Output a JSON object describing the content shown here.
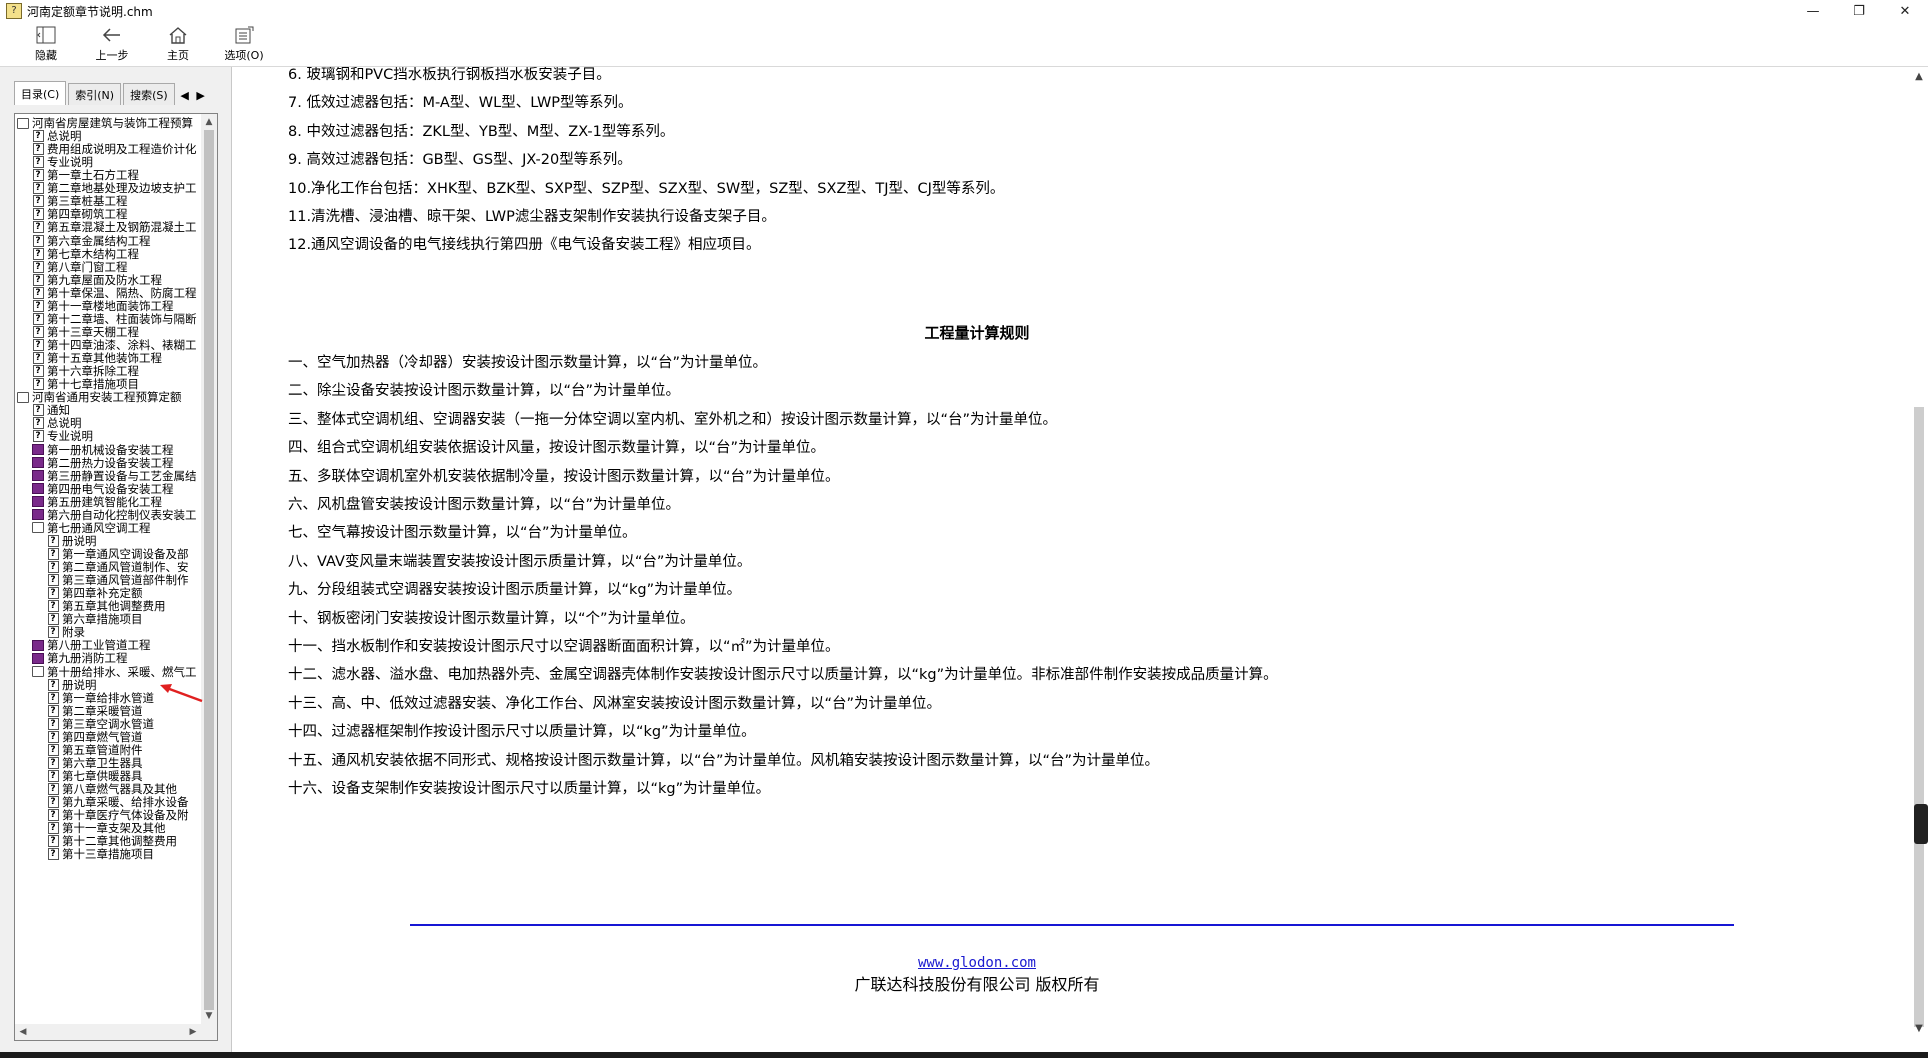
{
  "window": {
    "title": "河南定额章节说明.chm",
    "minimize": "—",
    "maximize": "❐",
    "close": "✕"
  },
  "toolbar": {
    "hide_label": "隐藏",
    "back_label": "上一步",
    "home_label": "主页",
    "options_label": "选项(O)"
  },
  "tabs": {
    "contents": "目录(C)",
    "index": "索引(N)",
    "search": "搜索(S)",
    "prev": "◀",
    "next": "▶"
  },
  "tree": [
    {
      "label": "河南省房屋建筑与装饰工程预算",
      "icon": "open-book-icon",
      "level": 0
    },
    {
      "label": "总说明",
      "icon": "q-icon",
      "level": 1
    },
    {
      "label": "费用组成说明及工程造价计化",
      "icon": "q-icon",
      "level": 1
    },
    {
      "label": "专业说明",
      "icon": "q-icon",
      "level": 1
    },
    {
      "label": "第一章土石方工程",
      "icon": "q-icon",
      "level": 1
    },
    {
      "label": "第二章地基处理及边坡支护工",
      "icon": "q-icon",
      "level": 1
    },
    {
      "label": "第三章桩基工程",
      "icon": "q-icon",
      "level": 1
    },
    {
      "label": "第四章砌筑工程",
      "icon": "q-icon",
      "level": 1
    },
    {
      "label": "第五章混凝土及钢筋混凝土工",
      "icon": "q-icon",
      "level": 1
    },
    {
      "label": "第六章金属结构工程",
      "icon": "q-icon",
      "level": 1
    },
    {
      "label": "第七章木结构工程",
      "icon": "q-icon",
      "level": 1
    },
    {
      "label": "第八章门窗工程",
      "icon": "q-icon",
      "level": 1
    },
    {
      "label": "第九章屋面及防水工程",
      "icon": "q-icon",
      "level": 1
    },
    {
      "label": "第十章保温、隔热、防腐工程",
      "icon": "q-icon",
      "level": 1
    },
    {
      "label": "第十一章楼地面装饰工程",
      "icon": "q-icon",
      "level": 1
    },
    {
      "label": "第十二章墙、柱面装饰与隔断",
      "icon": "q-icon",
      "level": 1
    },
    {
      "label": "第十三章天棚工程",
      "icon": "q-icon",
      "level": 1
    },
    {
      "label": "第十四章油漆、涂料、裱糊工",
      "icon": "q-icon",
      "level": 1
    },
    {
      "label": "第十五章其他装饰工程",
      "icon": "q-icon",
      "level": 1
    },
    {
      "label": "第十六章拆除工程",
      "icon": "q-icon",
      "level": 1
    },
    {
      "label": "第十七章措施项目",
      "icon": "q-icon",
      "level": 1
    },
    {
      "label": "河南省通用安装工程预算定额",
      "icon": "open-book-icon",
      "level": 0
    },
    {
      "label": "通知",
      "icon": "q-icon",
      "level": 1
    },
    {
      "label": "总说明",
      "icon": "q-icon",
      "level": 1
    },
    {
      "label": "专业说明",
      "icon": "q-icon",
      "level": 1
    },
    {
      "label": "第一册机械设备安装工程",
      "icon": "book-icon",
      "level": 1
    },
    {
      "label": "第二册热力设备安装工程",
      "icon": "book-icon",
      "level": 1
    },
    {
      "label": "第三册静置设备与工艺金属结",
      "icon": "book-icon",
      "level": 1
    },
    {
      "label": "第四册电气设备安装工程",
      "icon": "book-icon",
      "level": 1
    },
    {
      "label": "第五册建筑智能化工程",
      "icon": "book-icon",
      "level": 1
    },
    {
      "label": "第六册自动化控制仪表安装工",
      "icon": "book-icon",
      "level": 1
    },
    {
      "label": "第七册通风空调工程",
      "icon": "open-book-icon",
      "level": 1
    },
    {
      "label": "册说明",
      "icon": "q-icon",
      "level": 2
    },
    {
      "label": "第一章通风空调设备及部",
      "icon": "q-icon",
      "level": 2
    },
    {
      "label": "第二章通风管道制作、安",
      "icon": "q-icon",
      "level": 2
    },
    {
      "label": "第三章通风管道部件制作",
      "icon": "q-icon",
      "level": 2
    },
    {
      "label": "第四章补充定额",
      "icon": "q-icon",
      "level": 2
    },
    {
      "label": "第五章其他调整费用",
      "icon": "q-icon",
      "level": 2
    },
    {
      "label": "第六章措施项目",
      "icon": "q-icon",
      "level": 2
    },
    {
      "label": "附录",
      "icon": "q-icon",
      "level": 2
    },
    {
      "label": "第八册工业管道工程",
      "icon": "book-icon",
      "level": 1
    },
    {
      "label": "第九册消防工程",
      "icon": "book-icon",
      "level": 1
    },
    {
      "label": "第十册给排水、采暖、燃气工",
      "icon": "open-book-icon",
      "level": 1
    },
    {
      "label": "册说明",
      "icon": "q-icon",
      "level": 2
    },
    {
      "label": "第一章给排水管道",
      "icon": "q-icon",
      "level": 2
    },
    {
      "label": "第二章采暖管道",
      "icon": "q-icon",
      "level": 2
    },
    {
      "label": "第三章空调水管道",
      "icon": "q-icon",
      "level": 2
    },
    {
      "label": "第四章燃气管道",
      "icon": "q-icon",
      "level": 2
    },
    {
      "label": "第五章管道附件",
      "icon": "q-icon",
      "level": 2
    },
    {
      "label": "第六章卫生器具",
      "icon": "q-icon",
      "level": 2
    },
    {
      "label": "第七章供暖器具",
      "icon": "q-icon",
      "level": 2
    },
    {
      "label": "第八章燃气器具及其他",
      "icon": "q-icon",
      "level": 2
    },
    {
      "label": "第九章采暖、给排水设备",
      "icon": "q-icon",
      "level": 2
    },
    {
      "label": "第十章医疗气体设备及附",
      "icon": "q-icon",
      "level": 2
    },
    {
      "label": "第十一章支架及其他",
      "icon": "q-icon",
      "level": 2
    },
    {
      "label": "第十二章其他调整费用",
      "icon": "q-icon",
      "level": 2
    },
    {
      "label": "第十三章措施项目",
      "icon": "q-icon",
      "level": 2
    }
  ],
  "content": {
    "lines_top": [
      "6. 玻璃钢和PVC挡水板执行钢板挡水板安装子目。",
      "7. 低效过滤器包括：M-A型、WL型、LWP型等系列。",
      "8. 中效过滤器包括：ZKL型、YB型、M型、ZX-1型等系列。",
      "9. 高效过滤器包括：GB型、GS型、JX-20型等系列。",
      "10.净化工作台包括：XHK型、BZK型、SXP型、SZP型、SZX型、SW型，SZ型、SXZ型、TJ型、CJ型等系列。",
      "11.清洗槽、浸油槽、晾干架、LWP滤尘器支架制作安装执行设备支架子目。",
      "12.通风空调设备的电气接线执行第四册《电气设备安装工程》相应项目。"
    ],
    "heading": "工程量计算规则",
    "rules": [
      "一、空气加热器（冷却器）安装按设计图示数量计算，以“台”为计量单位。",
      "二、除尘设备安装按设计图示数量计算，以“台”为计量单位。",
      "三、整体式空调机组、空调器安装（一拖一分体空调以室内机、室外机之和）按设计图示数量计算，以“台”为计量单位。",
      "四、组合式空调机组安装依据设计风量，按设计图示数量计算，以“台”为计量单位。",
      "五、多联体空调机室外机安装依据制冷量，按设计图示数量计算，以“台”为计量单位。",
      "六、风机盘管安装按设计图示数量计算，以“台”为计量单位。",
      "七、空气幕按设计图示数量计算，以“台”为计量单位。",
      "八、VAV变风量末端装置安装按设计图示质量计算，以“台”为计量单位。",
      "九、分段组装式空调器安装按设计图示质量计算，以“kg”为计量单位。",
      "十、钢板密闭门安装按设计图示数量计算，以“个”为计量单位。",
      "十一、挡水板制作和安装按设计图示尺寸以空调器断面面积计算，以“㎡”为计量单位。",
      "十二、滤水器、溢水盘、电加热器外壳、金属空调器壳体制作安装按设计图示尺寸以质量计算，以“kg”为计量单位。非标准部件制作安装按成品质量计算。",
      "十三、高、中、低效过滤器安装、净化工作台、风淋室安装按设计图示数量计算，以“台”为计量单位。",
      "十四、过滤器框架制作按设计图示尺寸以质量计算，以“kg”为计量单位。",
      "十五、通风机安装依据不同形式、规格按设计图示数量计算，以“台”为计量单位。风机箱安装按设计图示数量计算，以“台”为计量单位。",
      "十六、设备支架制作安装按设计图示尺寸以质量计算，以“kg”为计量单位。"
    ],
    "footer_link": "www.glodon.com",
    "footer_copyright": "广联达科技股份有限公司 版权所有"
  },
  "colors": {
    "accent_link": "#1a1ad0",
    "divider": "#1717d4",
    "annotation_arrow": "#e02020"
  }
}
